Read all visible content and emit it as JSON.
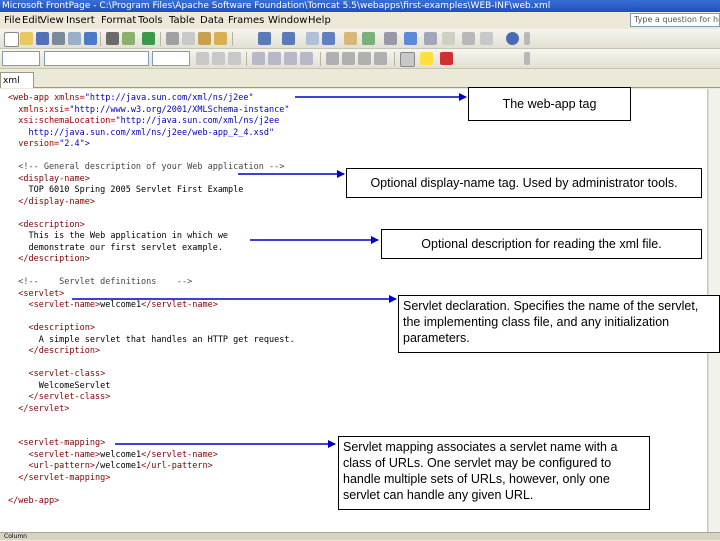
{
  "window": {
    "title": "Microsoft FrontPage - C:\\Program Files\\Apache Software Foundation\\Tomcat 5.5\\webapps\\first-examples\\WEB-INF\\web.xml"
  },
  "menu": [
    "File",
    "Edit",
    "View",
    "Insert",
    "Format",
    "Tools",
    "Table",
    "Data",
    "Frames",
    "Window",
    "Help"
  ],
  "help_search": {
    "placeholder": "Type a question for help"
  },
  "tab": {
    "label": "xml"
  },
  "status": {
    "text": "Column"
  },
  "code_lines": [
    {
      "line": 0,
      "t": [
        {
          "c": "tag",
          "s": "<web-app "
        },
        {
          "c": "attr",
          "s": "xmlns="
        },
        {
          "c": "val",
          "s": "\"http://java.sun.com/xml/ns/j2ee\""
        }
      ]
    },
    {
      "line": 1,
      "t": [
        {
          "c": "attr",
          "s": "  xmlns:xsi="
        },
        {
          "c": "val",
          "s": "\"http://www.w3.org/2001/XMLSchema-instance\""
        }
      ]
    },
    {
      "line": 2,
      "t": [
        {
          "c": "attr",
          "s": "  xsi:schemaLocation="
        },
        {
          "c": "val",
          "s": "\"http://java.sun.com/xml/ns/j2ee"
        }
      ]
    },
    {
      "line": 3,
      "t": [
        {
          "c": "val",
          "s": "    http://java.sun.com/xml/ns/j2ee/web-app_2_4.xsd\""
        }
      ]
    },
    {
      "line": 4,
      "t": [
        {
          "c": "attr",
          "s": "  version="
        },
        {
          "c": "val",
          "s": "\"2.4\">"
        }
      ]
    },
    {
      "line": 6,
      "t": [
        {
          "c": "com",
          "s": "  <!-- General description of your Web application -->"
        }
      ]
    },
    {
      "line": 7,
      "t": [
        {
          "c": "tag",
          "s": "  <display-name>"
        }
      ]
    },
    {
      "line": 8,
      "t": [
        {
          "c": "txt",
          "s": "    TOP 6010 Spring 2005 Servlet First Example"
        }
      ]
    },
    {
      "line": 9,
      "t": [
        {
          "c": "tag",
          "s": "  </display-name>"
        }
      ]
    },
    {
      "line": 11,
      "t": [
        {
          "c": "tag",
          "s": "  <description>"
        }
      ]
    },
    {
      "line": 12,
      "t": [
        {
          "c": "txt",
          "s": "    This is the Web application in which we"
        }
      ]
    },
    {
      "line": 13,
      "t": [
        {
          "c": "txt",
          "s": "    demonstrate our first servlet example."
        }
      ]
    },
    {
      "line": 14,
      "t": [
        {
          "c": "tag",
          "s": "  </description>"
        }
      ]
    },
    {
      "line": 16,
      "t": [
        {
          "c": "com",
          "s": "  <!--    Servlet definitions    -->"
        }
      ]
    },
    {
      "line": 17,
      "t": [
        {
          "c": "tag",
          "s": "  <servlet>"
        }
      ]
    },
    {
      "line": 18,
      "t": [
        {
          "c": "tag",
          "s": "    <servlet-name>"
        },
        {
          "c": "txt",
          "s": "welcome1"
        },
        {
          "c": "tag",
          "s": "</servlet-name>"
        }
      ]
    },
    {
      "line": 20,
      "t": [
        {
          "c": "tag",
          "s": "    <description>"
        }
      ]
    },
    {
      "line": 21,
      "t": [
        {
          "c": "txt",
          "s": "      A simple servlet that handles an HTTP get request."
        }
      ]
    },
    {
      "line": 22,
      "t": [
        {
          "c": "tag",
          "s": "    </description>"
        }
      ]
    },
    {
      "line": 24,
      "t": [
        {
          "c": "tag",
          "s": "    <servlet-class>"
        }
      ]
    },
    {
      "line": 25,
      "t": [
        {
          "c": "txt",
          "s": "      WelcomeServlet"
        }
      ]
    },
    {
      "line": 26,
      "t": [
        {
          "c": "tag",
          "s": "    </servlet-class>"
        }
      ]
    },
    {
      "line": 27,
      "t": [
        {
          "c": "tag",
          "s": "  </servlet>"
        }
      ]
    },
    {
      "line": 30,
      "t": [
        {
          "c": "tag",
          "s": "  <servlet-mapping>"
        }
      ]
    },
    {
      "line": 31,
      "t": [
        {
          "c": "tag",
          "s": "    <servlet-name>"
        },
        {
          "c": "txt",
          "s": "welcome1"
        },
        {
          "c": "tag",
          "s": "</servlet-name>"
        }
      ]
    },
    {
      "line": 32,
      "t": [
        {
          "c": "tag",
          "s": "    <url-pattern>"
        },
        {
          "c": "txt",
          "s": "/welcome1"
        },
        {
          "c": "tag",
          "s": "</url-pattern>"
        }
      ]
    },
    {
      "line": 33,
      "t": [
        {
          "c": "tag",
          "s": "  </servlet-mapping>"
        }
      ]
    },
    {
      "line": 35,
      "t": [
        {
          "c": "tag",
          "s": "</web-app>"
        }
      ]
    }
  ],
  "callouts": {
    "webapp": "The web-app tag",
    "display_name": "Optional display-name tag.  Used by administrator tools.",
    "description": "Optional description for reading the xml file.",
    "servlet": "Servlet declaration.  Specifies the name of the servlet, the implementing class file, and any initialization parameters.",
    "mapping": "Servlet mapping associates a servlet name with a class of URLs.  One servlet may be configured to handle multiple sets of URLs, however, only one servlet can handle any given URL."
  },
  "colors": {
    "callout_border": "#000000",
    "arrow": "#0000cc",
    "tag": "#800000",
    "value": "#0000c0"
  }
}
